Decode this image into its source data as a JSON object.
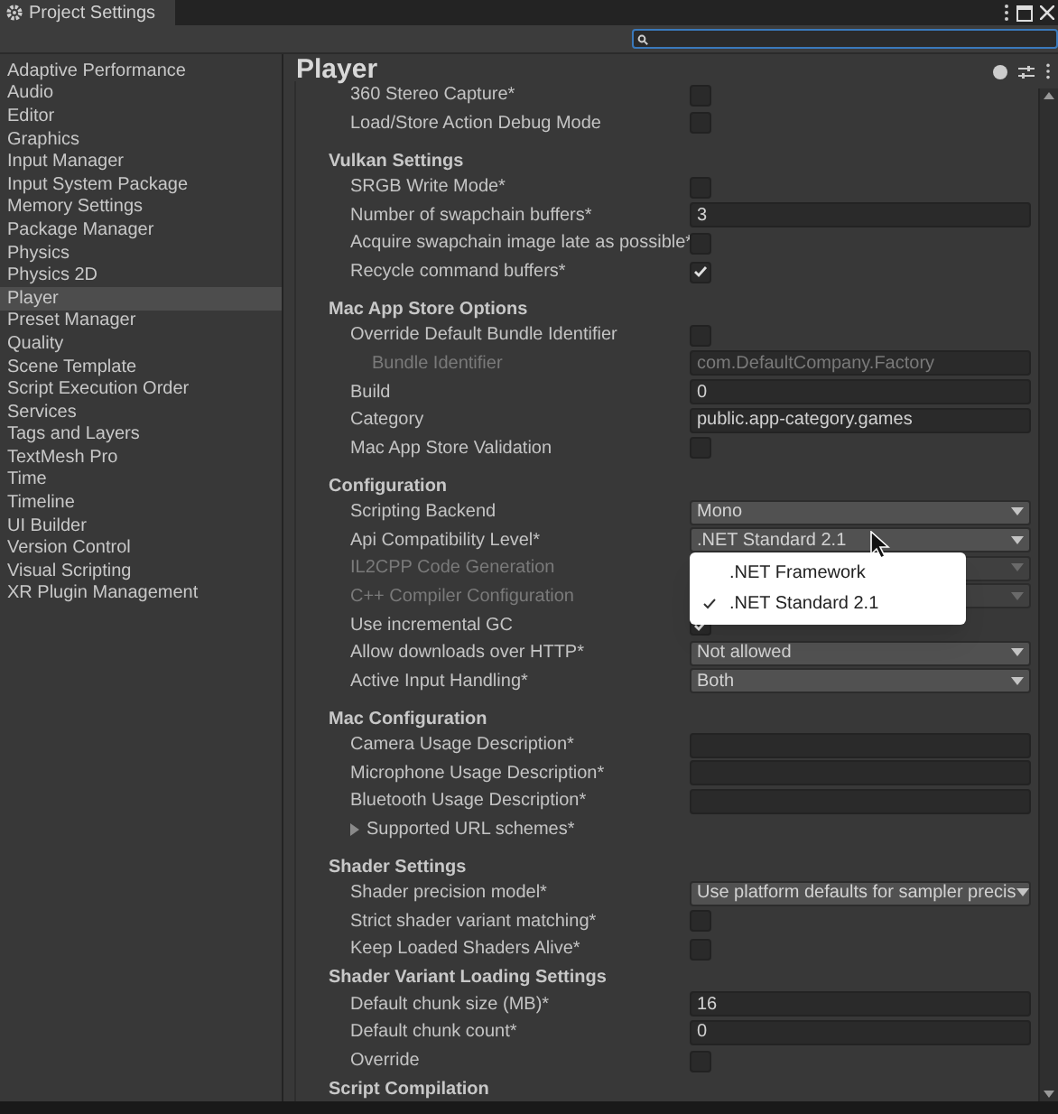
{
  "window": {
    "title": "Project Settings"
  },
  "sidebar": {
    "items": [
      {
        "label": "Adaptive Performance",
        "selected": false
      },
      {
        "label": "Audio",
        "selected": false
      },
      {
        "label": "Editor",
        "selected": false
      },
      {
        "label": "Graphics",
        "selected": false
      },
      {
        "label": "Input Manager",
        "selected": false
      },
      {
        "label": "Input System Package",
        "selected": false
      },
      {
        "label": "Memory Settings",
        "selected": false
      },
      {
        "label": "Package Manager",
        "selected": false
      },
      {
        "label": "Physics",
        "selected": false
      },
      {
        "label": "Physics 2D",
        "selected": false
      },
      {
        "label": "Player",
        "selected": true
      },
      {
        "label": "Preset Manager",
        "selected": false
      },
      {
        "label": "Quality",
        "selected": false
      },
      {
        "label": "Scene Template",
        "selected": false
      },
      {
        "label": "Script Execution Order",
        "selected": false
      },
      {
        "label": "Services",
        "selected": false
      },
      {
        "label": "Tags and Layers",
        "selected": false
      },
      {
        "label": "TextMesh Pro",
        "selected": false
      },
      {
        "label": "Time",
        "selected": false
      },
      {
        "label": "Timeline",
        "selected": false
      },
      {
        "label": "UI Builder",
        "selected": false
      },
      {
        "label": "Version Control",
        "selected": false
      },
      {
        "label": "Visual Scripting",
        "selected": false
      },
      {
        "label": "XR Plugin Management",
        "selected": false
      }
    ]
  },
  "panel": {
    "title": "Player",
    "rows": [
      {
        "kind": "checkbox",
        "label": "360 Stereo Capture*",
        "checked": false,
        "disabled": false
      },
      {
        "kind": "checkbox",
        "label": "Load/Store Action Debug Mode",
        "checked": false,
        "disabled": false
      },
      {
        "kind": "header",
        "label": "Vulkan Settings"
      },
      {
        "kind": "checkbox",
        "label": "SRGB Write Mode*",
        "checked": false,
        "disabled": false
      },
      {
        "kind": "text",
        "label": "Number of swapchain buffers*",
        "value": "3",
        "disabled": false
      },
      {
        "kind": "checkbox",
        "label": "Acquire swapchain image late as possible*",
        "checked": false,
        "disabled": false
      },
      {
        "kind": "checkbox",
        "label": "Recycle command buffers*",
        "checked": true,
        "disabled": false
      },
      {
        "kind": "header",
        "label": "Mac App Store Options"
      },
      {
        "kind": "checkbox",
        "label": "Override Default Bundle Identifier",
        "checked": false,
        "disabled": false
      },
      {
        "kind": "text",
        "label": "Bundle Identifier",
        "value": "com.DefaultCompany.Factory",
        "disabled": true
      },
      {
        "kind": "text",
        "label": "Build",
        "value": "0",
        "disabled": false
      },
      {
        "kind": "text",
        "label": "Category",
        "value": "public.app-category.games",
        "disabled": false
      },
      {
        "kind": "checkbox",
        "label": "Mac App Store Validation",
        "checked": false,
        "disabled": false
      },
      {
        "kind": "header",
        "label": "Configuration"
      },
      {
        "kind": "dropdown",
        "label": "Scripting Backend",
        "value": "Mono",
        "disabled": false
      },
      {
        "kind": "dropdown",
        "label": "Api Compatibility Level*",
        "value": ".NET Standard 2.1",
        "disabled": false,
        "open": true,
        "options": [
          {
            "label": ".NET Framework",
            "selected": false
          },
          {
            "label": ".NET Standard 2.1",
            "selected": true
          }
        ]
      },
      {
        "kind": "dropdown",
        "label": "IL2CPP Code Generation",
        "disabled": true
      },
      {
        "kind": "dropdown",
        "label": "C++ Compiler Configuration",
        "disabled": true
      },
      {
        "kind": "checkbox",
        "label": "Use incremental GC",
        "checked": true,
        "disabled": false
      },
      {
        "kind": "dropdown",
        "label": "Allow downloads over HTTP*",
        "value": "Not allowed",
        "disabled": false
      },
      {
        "kind": "dropdown",
        "label": "Active Input Handling*",
        "value": "Both",
        "disabled": false
      },
      {
        "kind": "header",
        "label": "Mac Configuration"
      },
      {
        "kind": "text",
        "label": "Camera Usage Description*",
        "value": "",
        "disabled": false
      },
      {
        "kind": "text",
        "label": "Microphone Usage Description*",
        "value": "",
        "disabled": false
      },
      {
        "kind": "text",
        "label": "Bluetooth Usage Description*",
        "value": "",
        "disabled": false
      },
      {
        "kind": "foldout",
        "label": "Supported URL schemes*",
        "expanded": false
      },
      {
        "kind": "header",
        "label": "Shader Settings"
      },
      {
        "kind": "dropdown",
        "label": "Shader precision model*",
        "value": "Use platform defaults for sampler precis",
        "disabled": false
      },
      {
        "kind": "checkbox",
        "label": "Strict shader variant matching*",
        "checked": false,
        "disabled": false
      },
      {
        "kind": "checkbox",
        "label": "Keep Loaded Shaders Alive*",
        "checked": false,
        "disabled": false
      },
      {
        "kind": "subheader",
        "label": "Shader Variant Loading Settings"
      },
      {
        "kind": "text",
        "label": "Default chunk size (MB)*",
        "value": "16",
        "disabled": false
      },
      {
        "kind": "text",
        "label": "Default chunk count*",
        "value": "0",
        "disabled": false
      },
      {
        "kind": "checkbox",
        "label": "Override",
        "checked": false,
        "disabled": false
      },
      {
        "kind": "subheader",
        "label": "Script Compilation"
      }
    ]
  }
}
